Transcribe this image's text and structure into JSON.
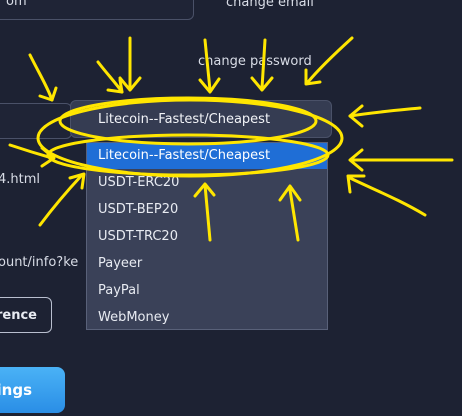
{
  "form": {
    "top_field_value": "om",
    "change_email_link": "change email",
    "change_password_link": "change password",
    "file_text": "4.html",
    "url_text": "ount/info?ke",
    "preference_button": "rence",
    "settings_button": "tings"
  },
  "payment_select": {
    "selected_value": "Litecoin--Fastest/Cheapest",
    "options": [
      {
        "label": "Litecoin--Fastest/Cheapest",
        "selected": true
      },
      {
        "label": "USDT-ERC20",
        "selected": false
      },
      {
        "label": "USDT-BEP20",
        "selected": false
      },
      {
        "label": "USDT-TRC20",
        "selected": false
      },
      {
        "label": "Payeer",
        "selected": false
      },
      {
        "label": "PayPal",
        "selected": false
      },
      {
        "label": "WebMoney",
        "selected": false
      }
    ]
  },
  "colors": {
    "background": "#1d2233",
    "dropdown_bg": "#3a4158",
    "selected_option": "#1f6ed6",
    "annotation": "#ffe600"
  }
}
